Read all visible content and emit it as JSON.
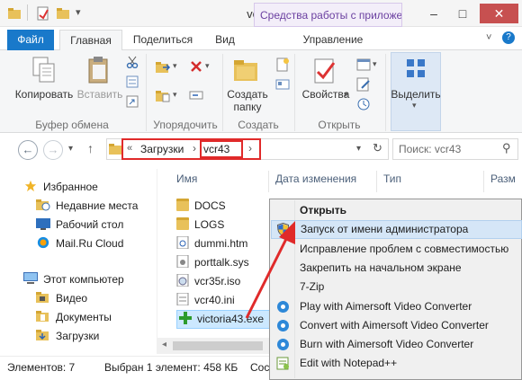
{
  "window": {
    "title": "vcr43",
    "tools_tab": "Средства работы с приложе...",
    "minimize": "–",
    "maximize": "□",
    "close": "✕"
  },
  "ribbon": {
    "tabs": {
      "file": "Файл",
      "home": "Главная",
      "share": "Поделиться",
      "view": "Вид",
      "manage": "Управление"
    },
    "help": "?",
    "expand": "˅",
    "clipboard": {
      "copy": "Копировать",
      "paste": "Вставить",
      "label": "Буфер обмена"
    },
    "organize": {
      "label": "Упорядочить"
    },
    "new": {
      "new_folder_line1": "Создать",
      "new_folder_line2": "папку",
      "label": "Создать"
    },
    "open": {
      "properties": "Свойства",
      "label": "Открыть"
    },
    "select": {
      "select_label": "Выделить"
    }
  },
  "address": {
    "back": "←",
    "forward": "→",
    "history": "▾",
    "up": "↑",
    "chevrons": "«",
    "crumb1": "Загрузки",
    "sep": "›",
    "crumb2": "vcr43",
    "dropdown": "▾",
    "refresh": "↻",
    "search_placeholder": "Поиск: vcr43",
    "search_icon": "⚲"
  },
  "columns": {
    "name": "Имя",
    "date": "Дата изменения",
    "type": "Тип",
    "size": "Разм"
  },
  "nav": {
    "favorites": "Избранное",
    "recent": "Недавние места",
    "desktop": "Рабочий стол",
    "mailru": "Mail.Ru Cloud",
    "computer": "Этот компьютер",
    "video": "Видео",
    "documents": "Документы",
    "downloads": "Загрузки"
  },
  "files": [
    {
      "name": "DOCS"
    },
    {
      "name": "LOGS"
    },
    {
      "name": "dummi.htm"
    },
    {
      "name": "porttalk.sys"
    },
    {
      "name": "vcr35r.iso"
    },
    {
      "name": "vcr40.ini"
    },
    {
      "name": "victoria43.exe"
    }
  ],
  "context_menu": {
    "items": [
      {
        "label": "Открыть"
      },
      {
        "label": "Запуск от имени администратора"
      },
      {
        "label": "Исправление проблем с совместимостью"
      },
      {
        "label": "Закрепить на начальном экране"
      },
      {
        "label": "7-Zip"
      },
      {
        "label": "Play with Aimersoft Video Converter"
      },
      {
        "label": "Convert with Aimersoft Video Converter"
      },
      {
        "label": "Burn with Aimersoft Video Converter"
      },
      {
        "label": "Edit with Notepad++"
      }
    ]
  },
  "status": {
    "count": "Элементов: 7",
    "selected": "Выбран 1 элемент: 458 КБ",
    "truncated": "Сос"
  },
  "colors": {
    "file_tab": "#1979ca",
    "tools_tab_text": "#6a3fa0",
    "highlight_box": "#e02a2a",
    "selection": "#cce8ff"
  }
}
